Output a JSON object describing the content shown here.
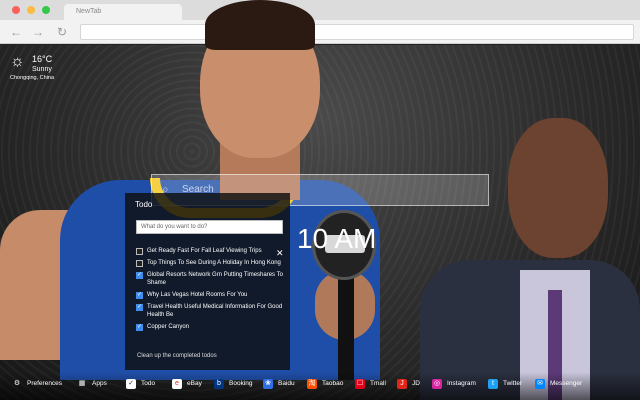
{
  "browser": {
    "tab_title": "NewTab",
    "nav": {
      "back_icon": "back-arrow-icon",
      "forward_icon": "forward-arrow-icon",
      "reload_icon": "reload-icon"
    }
  },
  "weather": {
    "temperature": "16°C",
    "condition": "Sunny",
    "location": "Chongqing, China",
    "icon": "sun-icon"
  },
  "search": {
    "placeholder": "Search"
  },
  "clock": {
    "time": "10 AM"
  },
  "todo": {
    "title": "Todo",
    "input_placeholder": "What do you want to do?",
    "items": [
      {
        "label": "Get Ready Fast For Fall Leaf Viewing Trips",
        "checked": false
      },
      {
        "label": "Top Things To See During A Holiday In Hong Kong",
        "checked": false
      },
      {
        "label": "Global Resorts Network Grn Putting Timeshares To Shame",
        "checked": true
      },
      {
        "label": "Why Las Vegas Hotel Rooms For You",
        "checked": true
      },
      {
        "label": "Travel Health Useful Medical Information For Good Health Be",
        "checked": true
      },
      {
        "label": "Copper Canyon",
        "checked": true
      }
    ],
    "clean_label": "Clean up the completed todos"
  },
  "bottom_bar": [
    {
      "label": "Preferences",
      "icon": "gear-icon",
      "color": "#00000000"
    },
    {
      "label": "Apps",
      "icon": "grid-icon",
      "color": "#00000000"
    },
    {
      "label": "Todo",
      "icon": "check-icon",
      "color": "#ffffff"
    },
    {
      "label": "eBay",
      "icon": "ebay-icon",
      "color": "#ffffff"
    },
    {
      "label": "Booking",
      "icon": "booking-icon",
      "color": "#003580"
    },
    {
      "label": "Baidu",
      "icon": "baidu-icon",
      "color": "#2f6ee6"
    },
    {
      "label": "Taobao",
      "icon": "taobao-icon",
      "color": "#ff5000"
    },
    {
      "label": "Tmall",
      "icon": "tmall-icon",
      "color": "#e3001b"
    },
    {
      "label": "JD",
      "icon": "jd-icon",
      "color": "#e1251b"
    },
    {
      "label": "Instagram",
      "icon": "instagram-icon",
      "color": "#d6249f"
    },
    {
      "label": "Twitter",
      "icon": "twitter-icon",
      "color": "#1da1f2"
    },
    {
      "label": "Messenger",
      "icon": "messenger-icon",
      "color": "#0084ff"
    }
  ]
}
